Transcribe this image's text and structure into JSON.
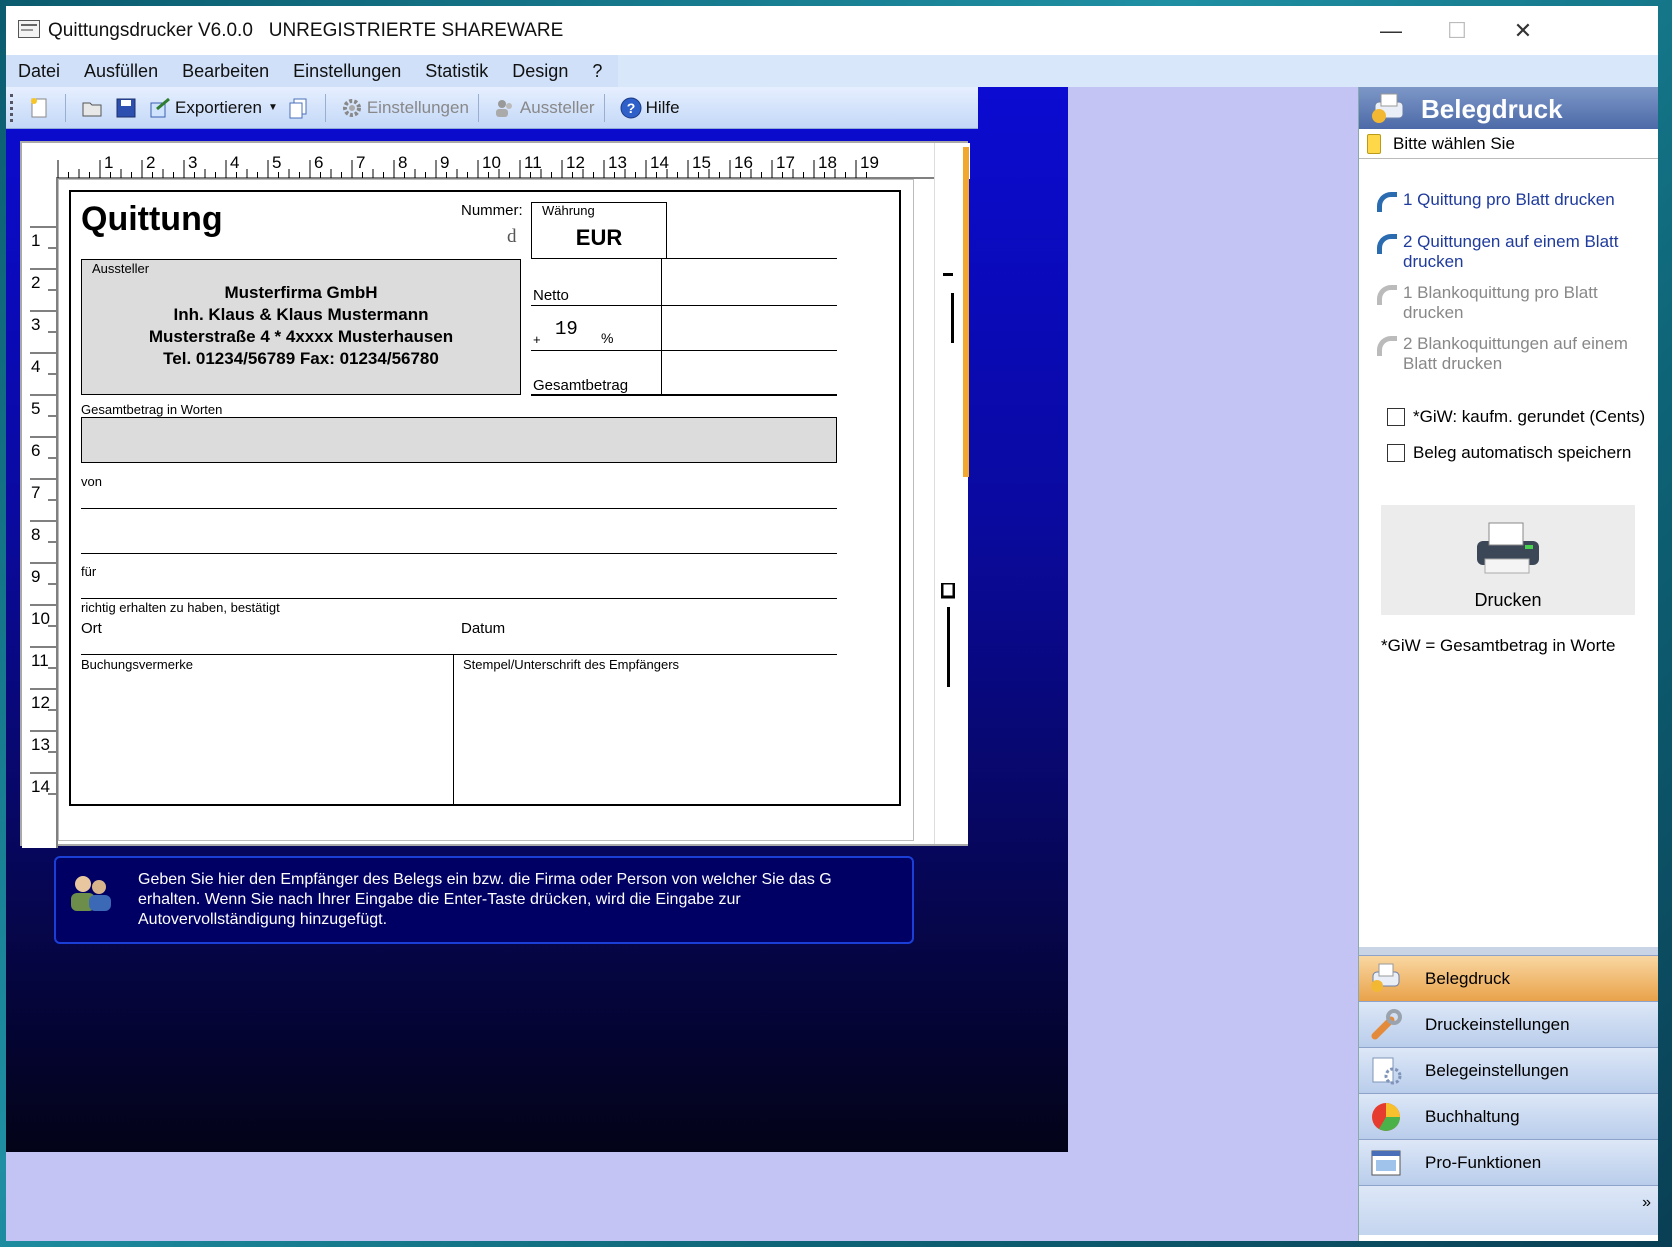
{
  "window": {
    "title": "Quittungsdrucker V6.0.0   UNREGISTRIERTE SHAREWARE",
    "controls": {
      "minimize": "—",
      "maximize": "☐",
      "close": "✕"
    }
  },
  "menu": [
    "Datei",
    "Ausfüllen",
    "Bearbeiten",
    "Einstellungen",
    "Statistik",
    "Design",
    "?"
  ],
  "toolbar": {
    "export": "Exportieren",
    "settings": "Einstellungen",
    "issuer": "Aussteller",
    "help": "Hilfe"
  },
  "ruler": {
    "top": [
      "1",
      "2",
      "3",
      "4",
      "5",
      "6",
      "7",
      "8",
      "9",
      "10",
      "11",
      "12",
      "13",
      "14",
      "15",
      "16",
      "17",
      "18",
      "19"
    ],
    "left": [
      "1",
      "2",
      "3",
      "4",
      "5",
      "6",
      "7",
      "8",
      "9",
      "10",
      "11",
      "12",
      "13",
      "14"
    ]
  },
  "receipt": {
    "title": "Quittung",
    "number_label": "Nummer:",
    "number_char": "d",
    "currency_label": "Währung",
    "currency": "EUR",
    "issuer_label": "Aussteller",
    "issuer_lines": [
      "Musterfirma GmbH",
      "Inh. Klaus & Klaus Mustermann",
      "Musterstraße 4  *  4xxxx Musterhausen",
      "Tel. 01234/56789  Fax: 01234/56780"
    ],
    "netto_label": "Netto",
    "tax_prefix": "+",
    "tax_rate": "19",
    "tax_percent": "%",
    "total_label": "Gesamtbetrag",
    "words_label": "Gesamtbetrag in Worten",
    "from_label": "von",
    "for_label": "für",
    "confirm_label": "richtig erhalten zu haben, bestätigt",
    "place_label": "Ort",
    "date_label": "Datum",
    "booking_label": "Buchungsvermerke",
    "stamp_label": "Stempel/Unterschrift des Empfängers"
  },
  "hint": {
    "text": "Geben Sie hier den Empfänger des Belegs ein bzw. die Firma oder Person von welcher Sie das G⁠ erhalten. Wenn Sie nach Ihrer Eingabe die Enter-Taste drücken, wird die Eingabe zur Autovervollständigung hinzugefügt."
  },
  "side_panel": {
    "title": "Belegdruck",
    "select_prompt": "Bitte wählen Sie",
    "links": [
      {
        "label": "1 Quittung pro Blatt drucken",
        "enabled": true
      },
      {
        "label": "2 Quittungen auf einem Blatt drucken",
        "enabled": true
      },
      {
        "label": "1 Blankoquittung pro Blatt drucken",
        "enabled": false
      },
      {
        "label": "2 Blankoquittungen auf einem Blatt drucken",
        "enabled": false
      }
    ],
    "checkboxes": [
      {
        "label": "*GiW: kaufm. gerundet (Cents)",
        "checked": false
      },
      {
        "label": "Beleg automatisch speichern",
        "checked": false
      }
    ],
    "print_button": "Drucken",
    "footnote": "*GiW = Gesamtbetrag in Worte",
    "nav": [
      "Belegdruck",
      "Druckeinstellungen",
      "Belegeinstellungen",
      "Buchhaltung",
      "Pro-Funktionen"
    ],
    "expand": "»"
  },
  "colors": {
    "window_bg": "#c3c3f4",
    "workarea_top": "#0b0bd2",
    "workarea_bottom": "#030318",
    "accent_orange": "#e9a24a",
    "link_blue": "#1f3b9c"
  }
}
